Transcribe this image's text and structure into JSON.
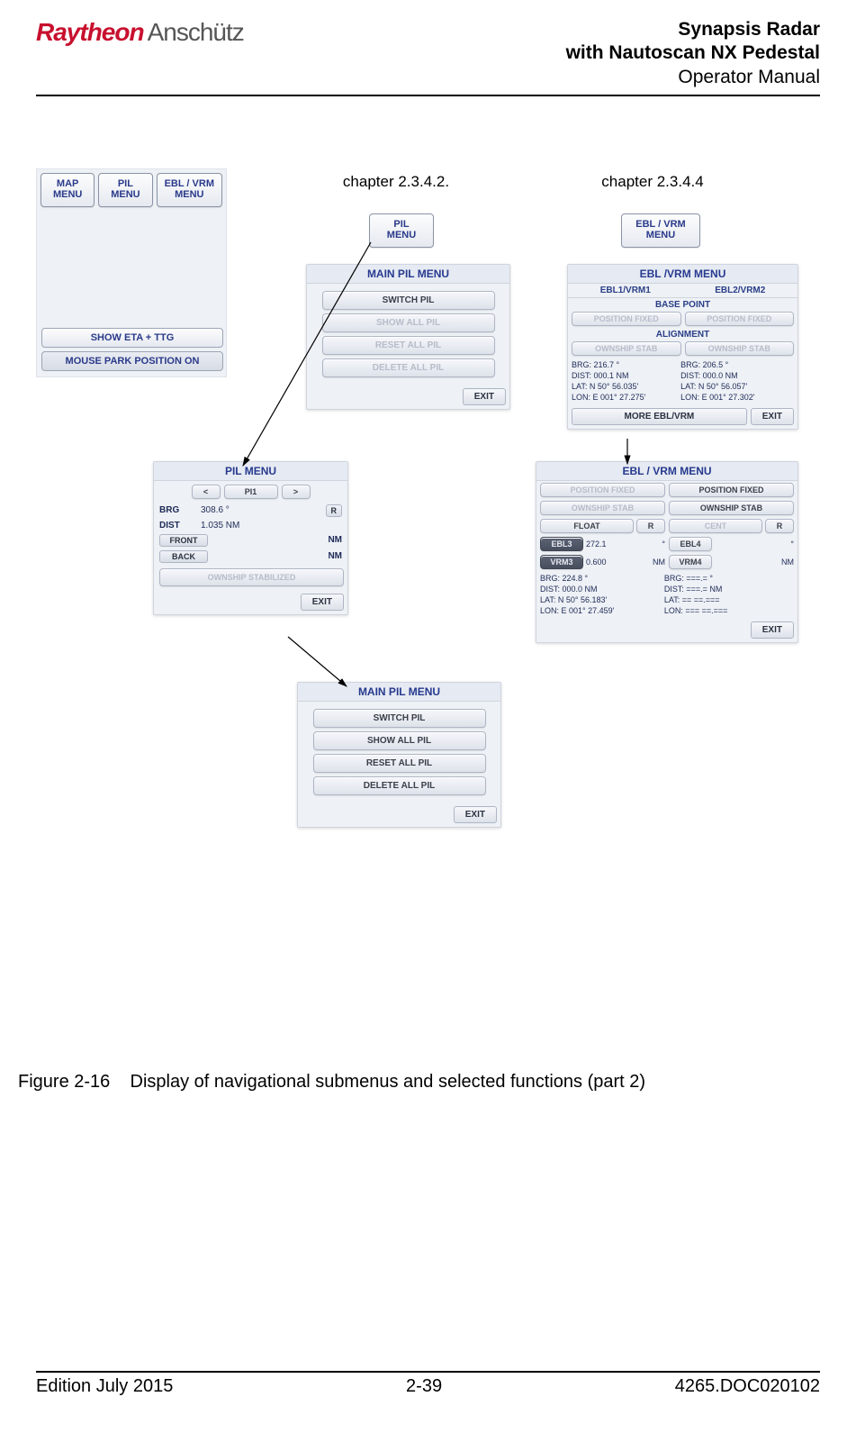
{
  "header": {
    "brand_left": "Raytheon",
    "brand_right": "Anschütz",
    "title1": "Synapsis Radar",
    "title2": "with Nautoscan NX Pedestal",
    "title3": "Operator Manual"
  },
  "footer": {
    "left": "Edition July 2015",
    "center": "2-39",
    "right": "4265.DOC020102"
  },
  "caption": {
    "num": "Figure 2-16",
    "text": "Display of navigational submenus and selected functions (part 2)"
  },
  "refs": {
    "pil": "chapter 2.3.4.2.",
    "ebl": "chapter 2.3.4.4"
  },
  "top_buttons": {
    "map": "MAP\nMENU",
    "pil": "PIL\nMENU",
    "ebl": "EBL / VRM\nMENU",
    "show_eta": "SHOW ETA + TTG",
    "mouse_park": "MOUSE PARK POSITION ON"
  },
  "standalone": {
    "pil": "PIL\nMENU",
    "ebl": "EBL / VRM\nMENU"
  },
  "main_pil_1": {
    "title": "MAIN PIL MENU",
    "switch": "SWITCH PIL",
    "show": "SHOW ALL PIL",
    "reset": "RESET ALL PIL",
    "delete": "DELETE ALL PIL",
    "exit": "EXIT"
  },
  "main_pil_2": {
    "title": "MAIN PIL MENU",
    "switch": "SWITCH PIL",
    "show": "SHOW ALL PIL",
    "reset": "RESET ALL PIL",
    "delete": "DELETE ALL PIL",
    "exit": "EXIT"
  },
  "pil_menu": {
    "title": "PIL MENU",
    "prev": "<",
    "item": "PI1",
    "next": ">",
    "brg_lab": "BRG",
    "brg_val": "308.6 °",
    "brg_r": "R",
    "dist_lab": "DIST",
    "dist_val": "1.035 NM",
    "front": "FRONT",
    "front_u": "NM",
    "back": "BACK",
    "back_u": "NM",
    "stab": "OWNSHIP STABILIZED",
    "exit": "EXIT"
  },
  "ebl_vrm": {
    "title": "EBL /VRM MENU",
    "t1": "EBL1/VRM1",
    "t2": "EBL2/VRM2",
    "base": "BASE POINT",
    "posfix_l": "POSITION FIXED",
    "posfix_r": "POSITION FIXED",
    "align": "ALIGNMENT",
    "own_l": "OWNSHIP STAB",
    "own_r": "OWNSHIP STAB",
    "l": {
      "brg": "BRG:  216.7  °",
      "dist": "DIST:  000.1  NM",
      "lat": "LAT:  N 50° 56.035'",
      "lon": "LON:  E 001° 27.275'"
    },
    "r": {
      "brg": "BRG:  206.5  °",
      "dist": "DIST:  000.0  NM",
      "lat": "LAT:  N 50° 56.057'",
      "lon": "LON:  E 001° 27.302'"
    },
    "more": "MORE EBL/VRM",
    "exit": "EXIT"
  },
  "ebl_vrm2": {
    "title": "EBL / VRM MENU",
    "posfix_dis": "POSITION FIXED",
    "posfix": "POSITION FIXED",
    "own_dis": "OWNSHIP STAB",
    "own": "OWNSHIP STAB",
    "float": "FLOAT",
    "r1": "R",
    "cent": "CENT",
    "r2": "R",
    "ebl3": "EBL3",
    "ebl3_v": "272.1",
    "ebl3_u": "°",
    "ebl4": "EBL4",
    "ebl4_u": "°",
    "vrm3": "VRM3",
    "vrm3_v": "0.600",
    "vrm3_u": "NM",
    "vrm4": "VRM4",
    "vrm4_u": "NM",
    "l": {
      "brg": "BRG:  224.8  °",
      "dist": "DIST:  000.0  NM",
      "lat": "LAT:  N 50° 56.183'",
      "lon": "LON:  E 001° 27.459'"
    },
    "r": {
      "brg": "BRG:  ===.=  °",
      "dist": "DIST:  ===.=  NM",
      "lat": "LAT:   ==  ==.===",
      "lon": "LON:   ===  ==.==="
    },
    "exit": "EXIT"
  }
}
